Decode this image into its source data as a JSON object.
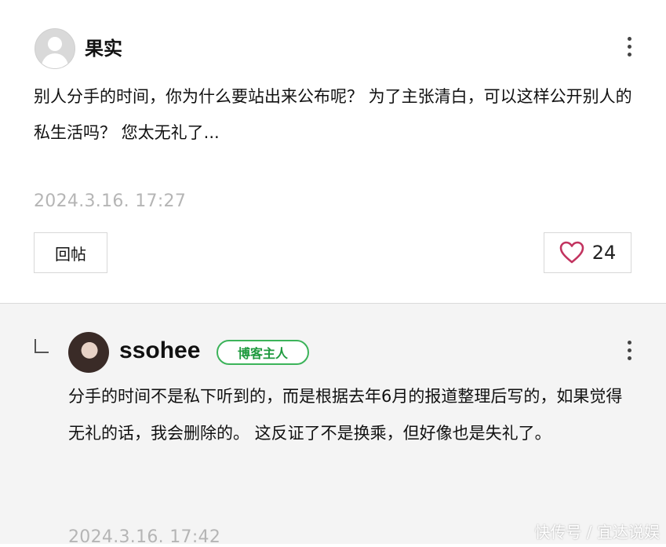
{
  "comment": {
    "username": "果实",
    "text": "别人分手的时间，你为什么要站出来公布呢？ 为了主张清白，可以这样公开别人的私生活吗？ 您太无礼了...",
    "timestamp": "2024.3.16. 17:27",
    "reply_button_label": "回帖",
    "like_count": "24"
  },
  "reply": {
    "username": "ssohee",
    "badge": "博客主人",
    "text": "分手的时间不是私下听到的，而是根据去年6月的报道整理后写的，如果觉得无礼的话，我会删除的。 这反证了不是换乘，但好像也是失礼了。",
    "timestamp": "2024.3.16. 17:42"
  },
  "watermark": "快传号 / 宜达说娱",
  "colors": {
    "badge_green": "#3cb35a",
    "reply_bg": "#f4f4f4",
    "timestamp_gray": "#b5b5b5",
    "heart_pink": "#c2335f"
  },
  "icons": [
    "default-avatar-icon",
    "more-vertical-icon",
    "heart-icon",
    "reply-indent-icon"
  ]
}
